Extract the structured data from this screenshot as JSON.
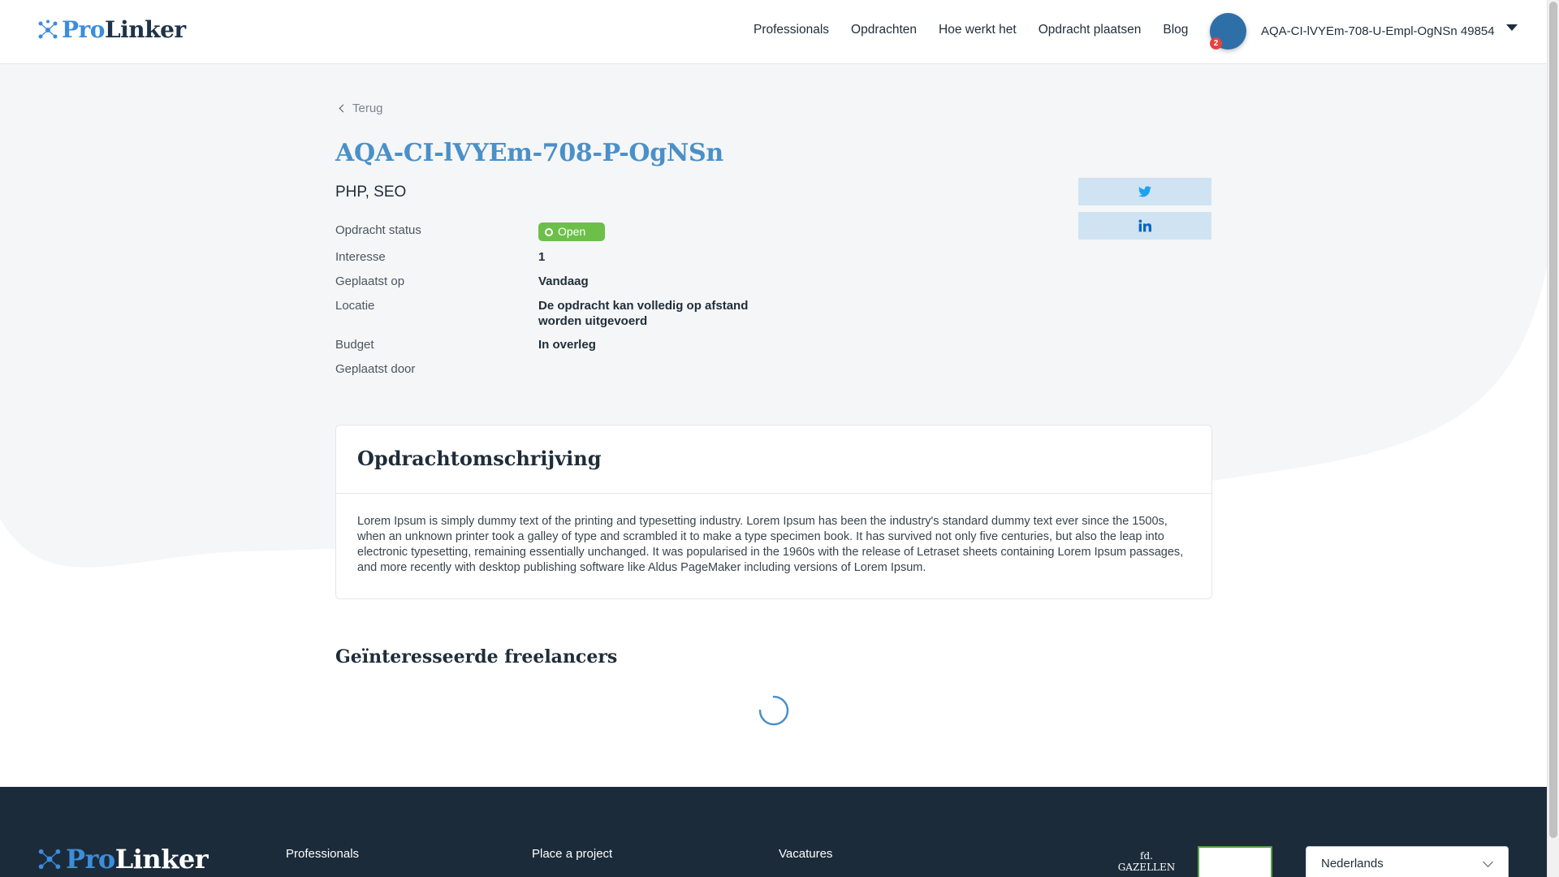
{
  "header": {
    "logo_pro": "Pro",
    "logo_linker": "Linker",
    "nav": [
      "Professionals",
      "Opdrachten",
      "Hoe werkt het",
      "Opdracht plaatsen",
      "Blog"
    ],
    "notification_count": "2",
    "user_name": "AQA-CI-lVYEm-708-U-Empl-OgNSn 49854"
  },
  "main": {
    "back_label": "Terug",
    "title": "AQA-CI-lVYEm-708-P-OgNSn",
    "skills": "PHP, SEO",
    "details": [
      {
        "label": "Opdracht status",
        "value": "Open"
      },
      {
        "label": "Interesse",
        "value": "1"
      },
      {
        "label": "Geplaatst op",
        "value": "Vandaag"
      },
      {
        "label": "Locatie",
        "value": "De opdracht kan volledig op afstand worden uitgevoerd"
      },
      {
        "label": "Budget",
        "value": "In overleg"
      },
      {
        "label": "Geplaatst door",
        "value": ""
      }
    ],
    "description_title": "Opdrachtomschrijving",
    "description": "Lorem Ipsum is simply dummy text of the printing and typesetting industry. Lorem Ipsum has been the industry's standard dummy text ever since the 1500s, when an unknown printer took a galley of type and scrambled it to make a type specimen book. It has survived not only five centuries, but also the leap into electronic typesetting, remaining essentially unchanged. It was popularised in the 1960s with the release of Letraset sheets containing Lorem Ipsum passages, and more recently with desktop publishing software like Aldus PageMaker including versions of Lorem Ipsum.",
    "interested_title": "Geïnteresseerde freelancers"
  },
  "footer": {
    "logo_pro": "Pro",
    "logo_linker": "Linker",
    "columns": [
      "Professionals",
      "Place a project",
      "Vacatures"
    ],
    "award1_label": "fd. GAZELLEN",
    "language": "Nederlands"
  },
  "colors": {
    "accent": "#4a90c9",
    "status_open": "#6cc04a",
    "footer_bg": "#1c2b3a"
  }
}
